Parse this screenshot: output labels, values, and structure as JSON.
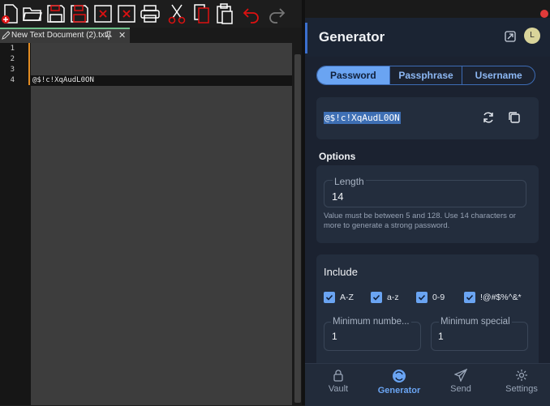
{
  "editor": {
    "toolbar": [
      "new-file-icon",
      "open-folder-icon",
      "save-icon",
      "save-all-icon",
      "close-icon",
      "close-all-icon",
      "print-icon",
      "cut-icon",
      "copy-icon",
      "paste-icon",
      "undo-icon",
      "redo-icon"
    ],
    "tab": {
      "title": "New Text Document (2).txt",
      "close": "✕"
    },
    "line_numbers": [
      "1",
      "2",
      "3",
      "4"
    ],
    "lines": [
      "",
      "",
      "",
      "@$!c!XqAudL0ON"
    ]
  },
  "generator": {
    "title": "Generator",
    "avatar_initial": "L",
    "tabs": [
      "Password",
      "Passphrase",
      "Username"
    ],
    "active_tab": "Password",
    "password": "@$!c!XqAudL0ON",
    "options_label": "Options",
    "length": {
      "label": "Length",
      "value": "14",
      "hint": "Value must be between 5 and 128. Use 14 characters or more to generate a strong password."
    },
    "include": {
      "label": "Include",
      "checks": [
        {
          "label": "A-Z",
          "checked": true
        },
        {
          "label": "a-z",
          "checked": true
        },
        {
          "label": "0-9",
          "checked": true
        },
        {
          "label": "!@#$%^&*",
          "checked": true
        }
      ],
      "min_numbers": {
        "label": "Minimum numbe...",
        "value": "1"
      },
      "min_special": {
        "label": "Minimum special",
        "value": "1"
      }
    },
    "nav": [
      {
        "label": "Vault",
        "icon": "lock-icon"
      },
      {
        "label": "Generator",
        "icon": "generator-icon"
      },
      {
        "label": "Send",
        "icon": "send-icon"
      },
      {
        "label": "Settings",
        "icon": "gear-icon"
      }
    ],
    "active_nav": "Generator",
    "accent": "#6aa4f2"
  }
}
